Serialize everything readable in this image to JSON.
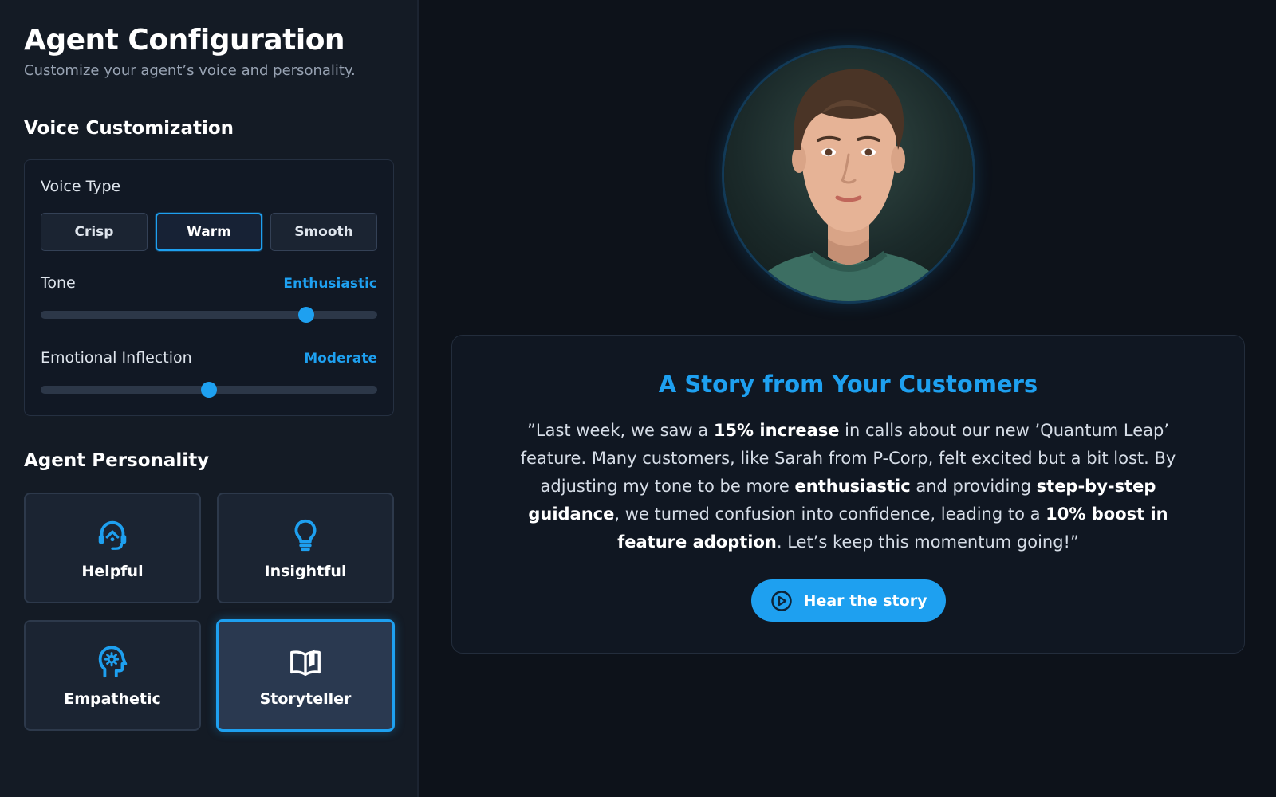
{
  "sidebar": {
    "title": "Agent Configuration",
    "subtitle": "Customize your agent’s voice and personality.",
    "voice_section_title": "Voice Customization",
    "voice_type_label": "Voice Type",
    "voice_types": [
      "Crisp",
      "Warm",
      "Smooth"
    ],
    "selected_voice": "Warm",
    "tone": {
      "label": "Tone",
      "value_label": "Enthusiastic",
      "level": 0.79
    },
    "inflection": {
      "label": "Emotional Inflection",
      "value_label": "Moderate",
      "level": 0.5
    },
    "personality_section_title": "Agent Personality",
    "personalities": [
      {
        "label": "Helpful",
        "icon": "headset-icon"
      },
      {
        "label": "Insightful",
        "icon": "lightbulb-icon"
      },
      {
        "label": "Empathetic",
        "icon": "head-gear-icon"
      },
      {
        "label": "Storyteller",
        "icon": "open-book-icon"
      }
    ],
    "selected_personality": "Storyteller"
  },
  "main": {
    "avatar_icon": "avatar-portrait",
    "story": {
      "title": "A Story from Your Customers",
      "body_parts": [
        {
          "text": "”Last week, we saw a ",
          "bold": false
        },
        {
          "text": "15% increase",
          "bold": true
        },
        {
          "text": " in calls about our new ’Quantum Leap’ feature. Many customers, like Sarah from P-Corp, felt excited but a bit lost. By adjusting my tone to be more ",
          "bold": false
        },
        {
          "text": "enthusiastic",
          "bold": true
        },
        {
          "text": " and providing ",
          "bold": false
        },
        {
          "text": "step-by-step guidance",
          "bold": true
        },
        {
          "text": ", we turned confusion into confidence, leading to a ",
          "bold": false
        },
        {
          "text": "10% boost in feature adoption",
          "bold": true
        },
        {
          "text": ". Let’s keep this momentum going!”",
          "bold": false
        }
      ],
      "button_label": "Hear the story",
      "button_icon": "play-circle-icon"
    }
  },
  "colors": {
    "accent": "#1ea0f0",
    "background": "#0d121a",
    "sidebar": "#141b25"
  }
}
